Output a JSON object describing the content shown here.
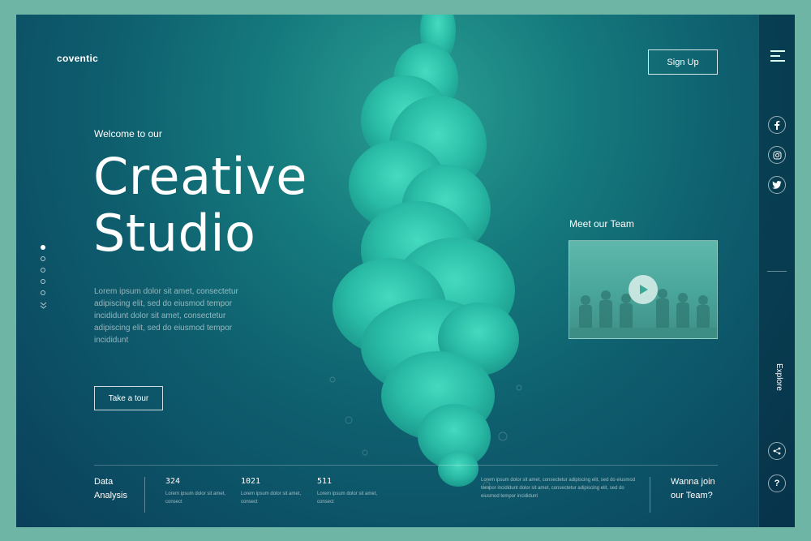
{
  "header": {
    "logo": "coventic",
    "signup_label": "Sign Up"
  },
  "hero": {
    "welcome": "Welcome to our",
    "title_line1": "Creative",
    "title_line2": "Studio",
    "description": "Lorem ipsum dolor sit amet, consectetur adipiscing elit, sed do eiusmod tempor incididunt dolor sit amet, consectetur adipiscing elit, sed do eiusmod tempor incididunt",
    "cta_label": "Take a tour"
  },
  "pagination": {
    "dots": 5,
    "active_index": 0
  },
  "team": {
    "label": "Meet our Team"
  },
  "sidebar": {
    "explore_label": "Explore",
    "social": [
      "facebook-icon",
      "instagram-icon",
      "twitter-icon"
    ]
  },
  "footer": {
    "section_label_line1": "Data",
    "section_label_line2": "Analysis",
    "stats": [
      {
        "number": "324",
        "desc": "Lorem ipsum dolor sit amet, consect"
      },
      {
        "number": "1021",
        "desc": "Lorem ipsum dolor sit amet, consect"
      },
      {
        "number": "511",
        "desc": "Lorem ipsum dolor sit amet, consect"
      }
    ],
    "paragraph": "Lorem ipsum dolor sit amet, consectetur adipiscing elit, sed do eiusmod tempor incididunt dolor sit amet, consectetur adipiscing elit, sed do eiusmod tempor incididunt",
    "join_line1": "Wanna join",
    "join_line2": "our Team?"
  },
  "colors": {
    "page_bg": "#6fb5a6",
    "panel_dark": "#0a3f5a",
    "accent_teal": "#2fc4ae"
  }
}
